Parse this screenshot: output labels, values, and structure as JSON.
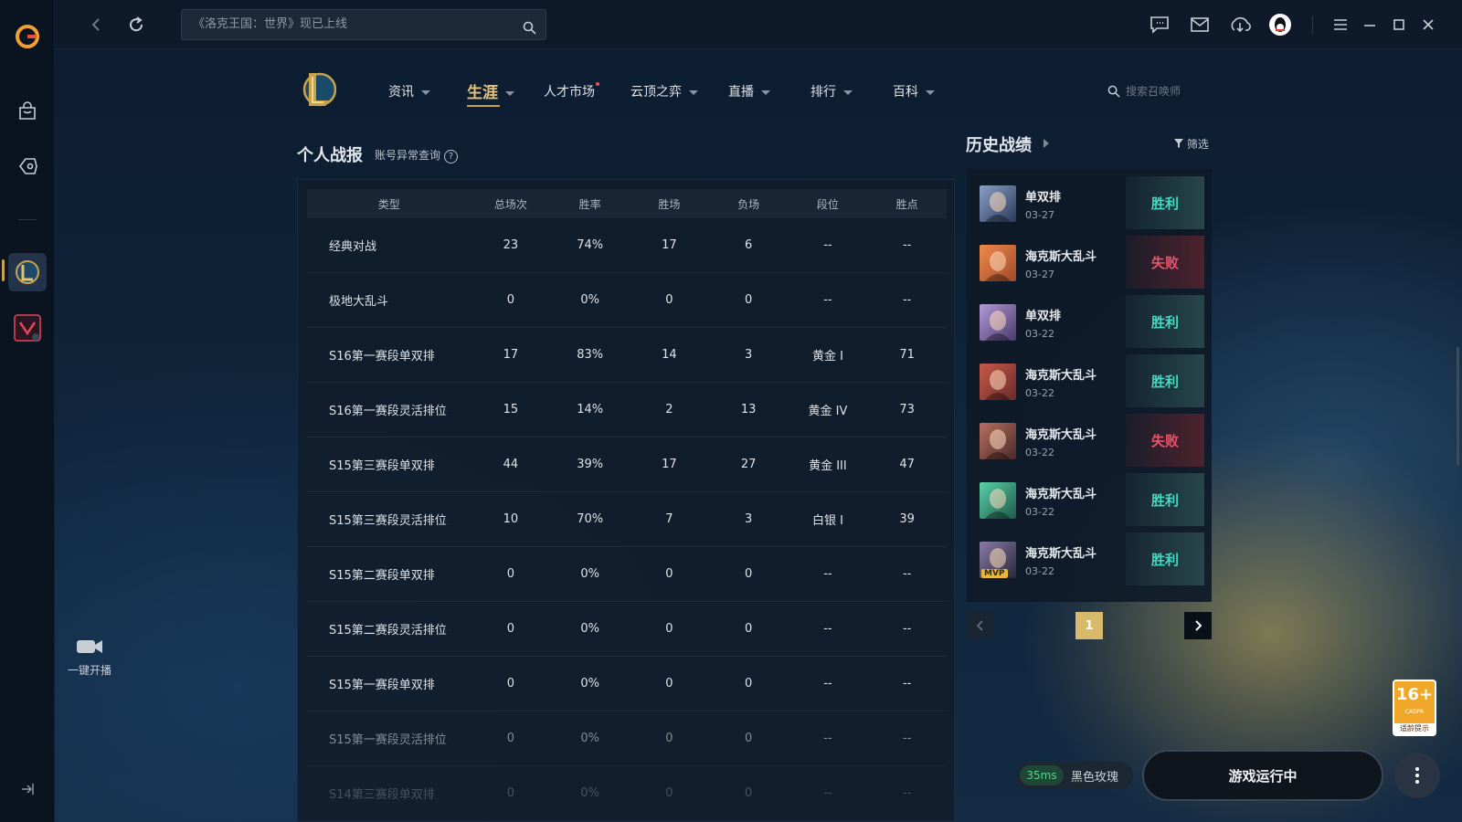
{
  "topbar": {
    "search_value": "《洛克王国：世界》现已上线"
  },
  "nav": {
    "items": [
      {
        "label": "资讯"
      },
      {
        "label": "生涯"
      },
      {
        "label": "人才市场"
      },
      {
        "label": "云顶之弈"
      },
      {
        "label": "直播"
      },
      {
        "label": "排行"
      },
      {
        "label": "百科"
      }
    ],
    "summoner_search_placeholder": "搜索召唤师"
  },
  "personal": {
    "title": "个人战报",
    "account_check": "账号异常查询",
    "help_icon": "?",
    "columns": [
      "类型",
      "总场次",
      "胜率",
      "胜场",
      "负场",
      "段位",
      "胜点"
    ],
    "rows": [
      {
        "type": "经典对战",
        "total": "23",
        "winrate": "74%",
        "wins": "17",
        "losses": "6",
        "tier": "--",
        "lp": "--"
      },
      {
        "type": "极地大乱斗",
        "total": "0",
        "winrate": "0%",
        "wins": "0",
        "losses": "0",
        "tier": "--",
        "lp": "--"
      },
      {
        "type": "S16第一赛段单双排",
        "total": "17",
        "winrate": "83%",
        "wins": "14",
        "losses": "3",
        "tier": "黄金 I",
        "lp": "71"
      },
      {
        "type": "S16第一赛段灵活排位",
        "total": "15",
        "winrate": "14%",
        "wins": "2",
        "losses": "13",
        "tier": "黄金 IV",
        "lp": "73"
      },
      {
        "type": "S15第三赛段单双排",
        "total": "44",
        "winrate": "39%",
        "wins": "17",
        "losses": "27",
        "tier": "黄金 III",
        "lp": "47"
      },
      {
        "type": "S15第三赛段灵活排位",
        "total": "10",
        "winrate": "70%",
        "wins": "7",
        "losses": "3",
        "tier": "白银 I",
        "lp": "39"
      },
      {
        "type": "S15第二赛段单双排",
        "total": "0",
        "winrate": "0%",
        "wins": "0",
        "losses": "0",
        "tier": "--",
        "lp": "--"
      },
      {
        "type": "S15第二赛段灵活排位",
        "total": "0",
        "winrate": "0%",
        "wins": "0",
        "losses": "0",
        "tier": "--",
        "lp": "--"
      },
      {
        "type": "S15第一赛段单双排",
        "total": "0",
        "winrate": "0%",
        "wins": "0",
        "losses": "0",
        "tier": "--",
        "lp": "--"
      },
      {
        "type": "S15第一赛段灵活排位",
        "total": "0",
        "winrate": "0%",
        "wins": "0",
        "losses": "0",
        "tier": "--",
        "lp": "--"
      },
      {
        "type": "S14第三赛段单双排",
        "total": "0",
        "winrate": "0%",
        "wins": "0",
        "losses": "0",
        "tier": "--",
        "lp": "--"
      }
    ]
  },
  "history": {
    "title": "历史战绩",
    "filter_label": "筛选",
    "matches": [
      {
        "mode": "单双排",
        "date": "03-27",
        "result": "胜利",
        "outcome": "win"
      },
      {
        "mode": "海克斯大乱斗",
        "date": "03-27",
        "result": "失败",
        "outcome": "loss"
      },
      {
        "mode": "单双排",
        "date": "03-22",
        "result": "胜利",
        "outcome": "win"
      },
      {
        "mode": "海克斯大乱斗",
        "date": "03-22",
        "result": "胜利",
        "outcome": "win"
      },
      {
        "mode": "海克斯大乱斗",
        "date": "03-22",
        "result": "失败",
        "outcome": "loss"
      },
      {
        "mode": "海克斯大乱斗",
        "date": "03-22",
        "result": "胜利",
        "outcome": "win"
      },
      {
        "mode": "海克斯大乱斗",
        "date": "03-22",
        "result": "胜利",
        "outcome": "win",
        "badge": "MVP"
      }
    ],
    "current_page": "1"
  },
  "sidebar": {
    "live_label": "一键开播"
  },
  "status": {
    "ping": "35ms",
    "server": "黑色玫瑰",
    "game_state": "游戏运行中"
  },
  "age_rating": {
    "age": "16+",
    "org": "CADPA",
    "note": "适龄提示"
  },
  "colors": {
    "accent_gold": "#c9a34c",
    "win": "#45d8c2",
    "loss": "#e9556a"
  }
}
